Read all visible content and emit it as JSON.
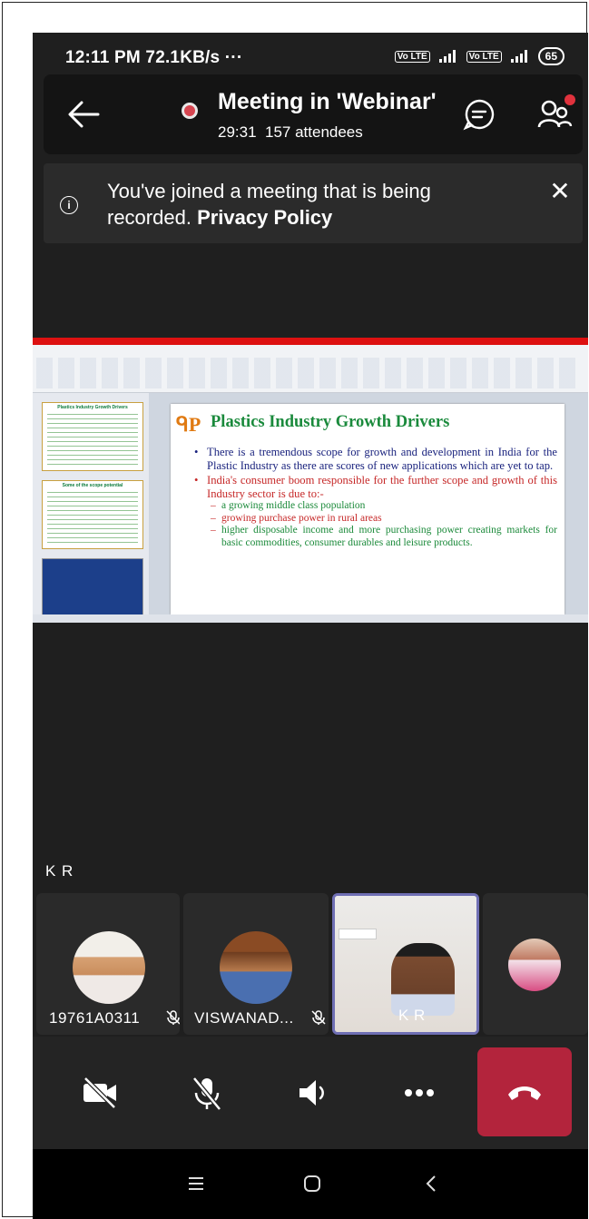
{
  "status_bar": {
    "time": "12:11 PM",
    "speed": "72.1KB/s",
    "more": "···",
    "lte1": "Vo LTE",
    "net": "4G",
    "lte2": "Vo LTE",
    "battery": "65"
  },
  "meeting": {
    "title": "Meeting in 'Webinar'",
    "duration": "29:31",
    "attendees": "157 attendees",
    "icons": {
      "back": "back-arrow-icon",
      "record": "recording-dot-icon",
      "chat": "chat-icon",
      "participants": "people-icon"
    }
  },
  "banner": {
    "text": "You've joined a meeting that is being recorded. ",
    "link": "Privacy Policy"
  },
  "presentation": {
    "logo": "ᑫP",
    "title": "Plastics Industry Growth Drivers",
    "bullets": [
      {
        "text": "There is a tremendous scope for growth and development in India for the Plastic Industry as there are scores of new applications which are yet to tap."
      },
      {
        "text": "India's consumer boom responsible for the further scope and growth of this Industry sector is due to:-"
      }
    ],
    "subpoints": [
      "a growing middle class population",
      "growing purchase power in rural areas",
      "higher disposable income and more purchasing power creating markets for basic commodities, consumer durables and leisure products."
    ],
    "thumbnails": [
      "Plastics Industry Growth Drivers",
      "Some of the scope potential",
      ""
    ]
  },
  "active_speaker_label": "K R",
  "participants": [
    {
      "name": "19761A0311",
      "muted": true
    },
    {
      "name": "VISWANAD...",
      "muted": true
    },
    {
      "name": "K R",
      "muted": false
    },
    {
      "name": "",
      "muted": false
    }
  ],
  "controls": {
    "camera": "camera-off-icon",
    "mic": "mic-off-icon",
    "speaker": "speaker-icon",
    "more": "more-icon",
    "end": "end-call-icon"
  },
  "nav": {
    "menu": "menu-icon",
    "home": "home-icon",
    "back": "back-icon"
  },
  "colors": {
    "accent": "#6f6fb4",
    "end_call": "#b3243c",
    "record": "#d64550"
  }
}
